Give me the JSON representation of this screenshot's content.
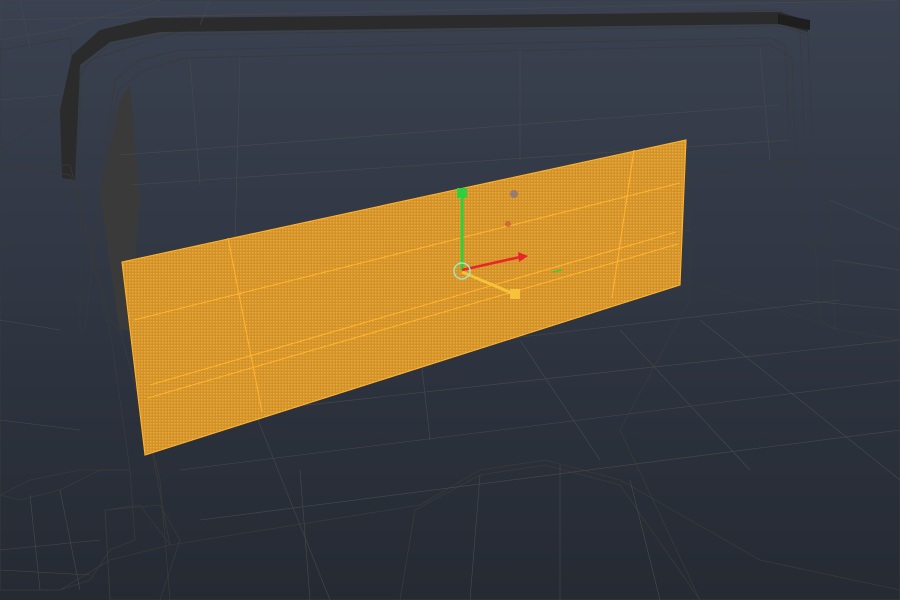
{
  "viewport": {
    "name": "3d-viewport",
    "background_color": "#2d333d",
    "mesh_color": "#9c9c9c",
    "selection_color": "#f7a826",
    "selection": {
      "type": "faces",
      "highlighted": true
    },
    "manipulator": {
      "type": "move",
      "axis_colors": {
        "x": "#e8262a",
        "y": "#2ed13c",
        "z": "#f6c23a"
      },
      "center": "pivot-ring"
    }
  }
}
